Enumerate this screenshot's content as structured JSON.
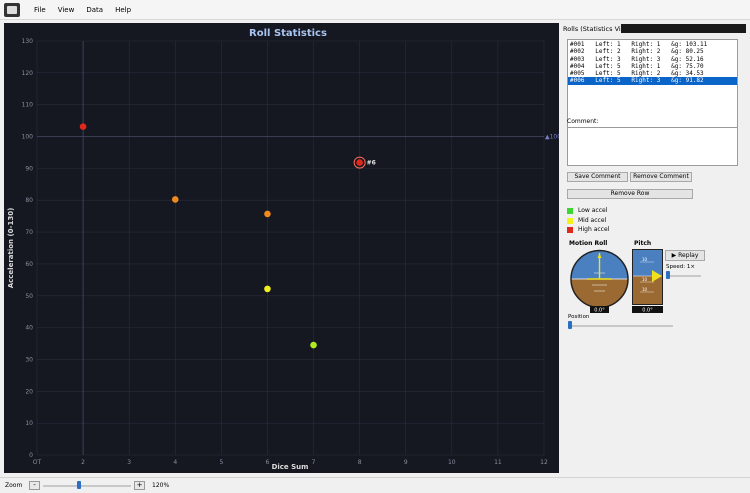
{
  "menu": [
    "File",
    "View",
    "Data",
    "Help"
  ],
  "chart_data": {
    "type": "scatter",
    "title": "Roll Statistics",
    "xlabel": "Dice Sum",
    "ylabel": "Acceleration (0-130)",
    "xlim": [
      1,
      12
    ],
    "ylim": [
      0,
      130
    ],
    "x_ticks": [
      "OT",
      "2",
      "3",
      "4",
      "5",
      "6",
      "7",
      "8",
      "9",
      "10",
      "11",
      "12"
    ],
    "y_ticks": [
      0,
      10,
      20,
      30,
      40,
      50,
      60,
      70,
      80,
      90,
      100,
      110,
      120,
      130
    ],
    "points": [
      {
        "x": 2,
        "y": 103.11,
        "color": "#e0281d"
      },
      {
        "x": 4,
        "y": 80.25,
        "color": "#f08a1e"
      },
      {
        "x": 6,
        "y": 75.7,
        "color": "#f08a1e"
      },
      {
        "x": 6,
        "y": 52.16,
        "color": "#f0f020"
      },
      {
        "x": 7,
        "y": 34.53,
        "color": "#b0ec20"
      },
      {
        "x": 8,
        "y": 91.82,
        "color": "#e0281d",
        "label": "#6",
        "selected": true
      }
    ],
    "crosshair": {
      "x": 2,
      "y": 100
    },
    "crosshair_label": "100",
    "grid": true
  },
  "rolls_panel": {
    "title": "Rolls (Statistics View)",
    "rows": [
      "#001   Left: 1   Right: 1   &g: 103.11",
      "#002   Left: 2   Right: 2   &g: 80.25",
      "#003   Left: 3   Right: 3   &g: 52.16",
      "#004   Left: 5   Right: 1   &g: 75.70",
      "#005   Left: 5   Right: 2   &g: 34.53",
      "#006   Left: 5   Right: 3   &g: 91.82"
    ],
    "selected_index": 5,
    "comment_label": "Comment:",
    "comment_value": "",
    "save_label": "Save Comment",
    "remove_comment_label": "Remove Comment",
    "remove_row_label": "Remove Row"
  },
  "legend": [
    {
      "label": "Low accel",
      "color": "#3dd633"
    },
    {
      "label": "Mid accel",
      "color": "#f2f21c"
    },
    {
      "label": "High accel",
      "color": "#e0281d"
    }
  ],
  "motion": {
    "roll_label": "Motion Roll",
    "pitch_label": "Pitch",
    "roll_value": "0.0°",
    "pitch_value": "0.0°",
    "pitch_scale": [
      "10",
      "10",
      "10"
    ],
    "replay_label": "▶ Replay",
    "speed_label": "Speed: 1×",
    "position_label": "Position",
    "speed_level": 0,
    "position_level": 0,
    "sky_color": "#4a7fc0",
    "ground_color": "#9a6a32"
  },
  "status": {
    "zoom_label": "Zoom",
    "zoom_value": "120%",
    "zoom_level": 0.4
  }
}
